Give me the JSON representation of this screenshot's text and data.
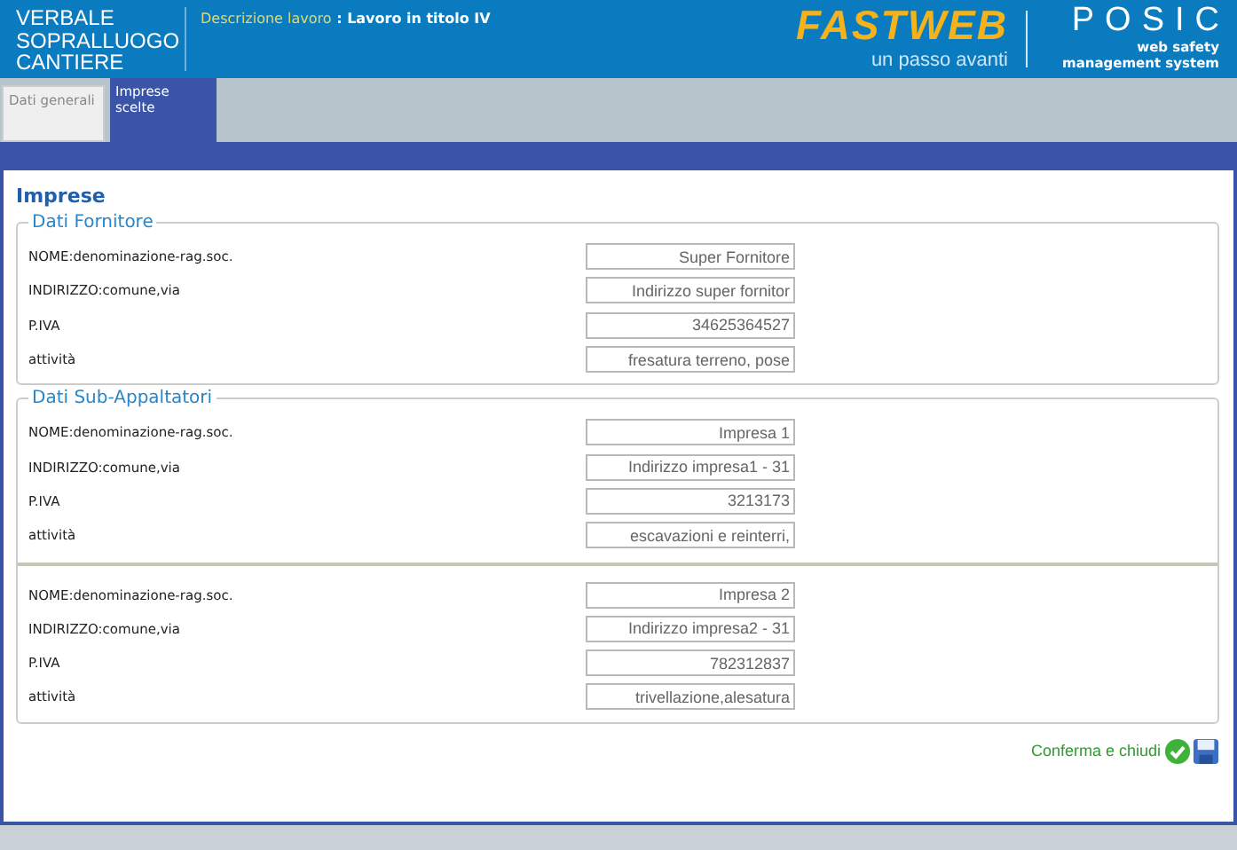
{
  "header": {
    "title_lines": [
      "VERBALE",
      "SOPRALLUOGO",
      "CANTIERE"
    ],
    "job_label": "Descrizione lavoro",
    "job_value": ": Lavoro in titolo IV",
    "brand": "FASTWEB",
    "tagline": "un passo avanti",
    "product": "POSIC",
    "product_tagline": [
      "web safety",
      "management system"
    ]
  },
  "tabs": [
    {
      "label": "Dati generali",
      "selected": false
    },
    {
      "label": "Imprese scelte",
      "selected": true
    }
  ],
  "section_title": "Imprese",
  "supplier": {
    "legend": "Dati Fornitore",
    "fields": [
      {
        "label": "NOME:denominazione-rag.soc.",
        "value": "Super Fornitore"
      },
      {
        "label": "INDIRIZZO:comune,via",
        "value": "Indirizzo super fornitor"
      },
      {
        "label": "P.IVA",
        "value": "34625364527"
      },
      {
        "label": "attività",
        "value": "fresatura terreno, pose"
      }
    ]
  },
  "subcontractors": {
    "legend": "Dati Sub-Appaltatori",
    "companies": [
      [
        {
          "label": "NOME:denominazione-rag.soc.",
          "value": "Impresa 1"
        },
        {
          "label": "INDIRIZZO:comune,via",
          "value": "Indirizzo impresa1 - 31"
        },
        {
          "label": "P.IVA",
          "value": "3213173"
        },
        {
          "label": "attività",
          "value": "escavazioni e reinterri,"
        }
      ],
      [
        {
          "label": "NOME:denominazione-rag.soc.",
          "value": "Impresa 2"
        },
        {
          "label": "INDIRIZZO:comune,via",
          "value": "Indirizzo impresa2 - 31"
        },
        {
          "label": "P.IVA",
          "value": "782312837"
        },
        {
          "label": "attività",
          "value": "trivellazione,alesatura"
        }
      ]
    ]
  },
  "confirm": {
    "label": "Conferma e chiudi"
  }
}
